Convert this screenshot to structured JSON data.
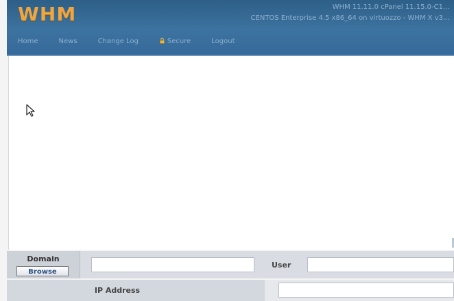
{
  "header": {
    "logo": "WHM",
    "version": "WHM 11.11.0 cPanel 11.15.0-C1…",
    "system": "CENTOS Enterprise 4.5 x86_64 on virtuozzo - WHM X v3…",
    "nav": [
      {
        "label": "Home"
      },
      {
        "label": "News"
      },
      {
        "label": "Change Log"
      },
      {
        "label": "Secure"
      },
      {
        "label": "Logout"
      }
    ]
  },
  "form": {
    "domain_label": "Domain",
    "browse_label": "Browse",
    "domain_value": "",
    "user_label": "User",
    "user_value": "",
    "ip_label": "IP Address",
    "ip_value": ""
  },
  "colors": {
    "header_bg": "#3d73a0",
    "logo": "#f0a53e",
    "nav_text": "#8fb0cf"
  }
}
